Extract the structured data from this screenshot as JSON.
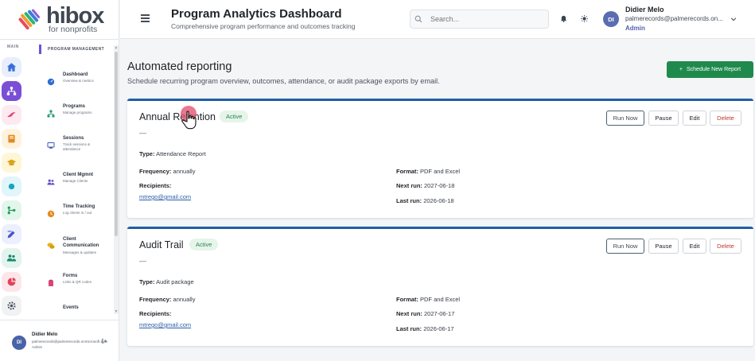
{
  "brand": {
    "name": "hibox",
    "tagline": "for nonprofits"
  },
  "rail": {
    "label": "MAIN",
    "icons": [
      "home-icon",
      "hierarchy-icon",
      "bird-icon",
      "book-icon",
      "graduation-icon",
      "circle-icon",
      "git-branch-icon",
      "pen-icon",
      "people-icon",
      "pie-chart-icon",
      "settings-icon"
    ]
  },
  "menu": {
    "heading": "PROGRAM MANAGEMENT",
    "items": [
      {
        "title": "Dashboard",
        "sub": "Overview & metrics",
        "icon": "dashboard-icon"
      },
      {
        "title": "Programs",
        "sub": "Manage programs",
        "icon": "programs-icon"
      },
      {
        "title": "Sessions",
        "sub": "Track sessions & attendance",
        "icon": "sessions-icon"
      },
      {
        "title": "Client Mgmnt",
        "sub": "Manage Clients",
        "icon": "clients-icon"
      },
      {
        "title": "Time Tracking",
        "sub": "Log clients in / out",
        "icon": "clock-icon"
      },
      {
        "title": "Client Communication",
        "sub": "Messages & updates",
        "icon": "chat-icon"
      },
      {
        "title": "Forms",
        "sub": "Links & QR codes",
        "icon": "forms-icon"
      },
      {
        "title": "Events",
        "sub": "",
        "icon": "events-icon"
      }
    ]
  },
  "sidebar_user": {
    "initials": "DI",
    "name": "Didier Melo",
    "email": "palmerecords@palmerecords.onmicrosoft.com",
    "role": "Admin"
  },
  "header": {
    "title": "Program Analytics Dashboard",
    "subtitle": "Comprehensive program performance and outcomes tracking",
    "search_placeholder": "Search...",
    "user": {
      "initials": "DI",
      "name": "Didier Melo",
      "email": "palmerecords@palmerecords.on...",
      "role": "Admin"
    }
  },
  "page": {
    "title": "Automated reporting",
    "subtitle": "Schedule recurring program overview, outcomes, attendance, or audit package exports by email.",
    "schedule_button": "Schedule New Report"
  },
  "labels": {
    "type": "Type:",
    "frequency": "Frequency:",
    "recipients": "Recipients:",
    "format": "Format:",
    "next_run": "Next run:",
    "last_run": "Last run:"
  },
  "actions": {
    "run": "Run Now",
    "pause": "Pause",
    "edit": "Edit",
    "delete": "Delete"
  },
  "reports": [
    {
      "name": "Annual Retention",
      "status": "Active",
      "description": "—",
      "type": "Attendance Report",
      "frequency": "annually",
      "recipients": "mtrego@gmail.com",
      "format": "PDF and Excel",
      "next_run": "2027-06-18",
      "last_run": "2026-06-18"
    },
    {
      "name": "Audit Trail",
      "status": "Active",
      "description": "—",
      "type": "Audit package",
      "frequency": "annually",
      "recipients": "mtrego@gmail.com",
      "format": "PDF and Excel",
      "next_run": "2027-06-17",
      "last_run": "2026-06-17"
    }
  ],
  "colors": {
    "accent": "#1f8a4c",
    "card_border": "#1f5fa8",
    "menu_accent": "#6f4fd8",
    "link": "#2d5fa8",
    "delete": "#c0392b"
  }
}
